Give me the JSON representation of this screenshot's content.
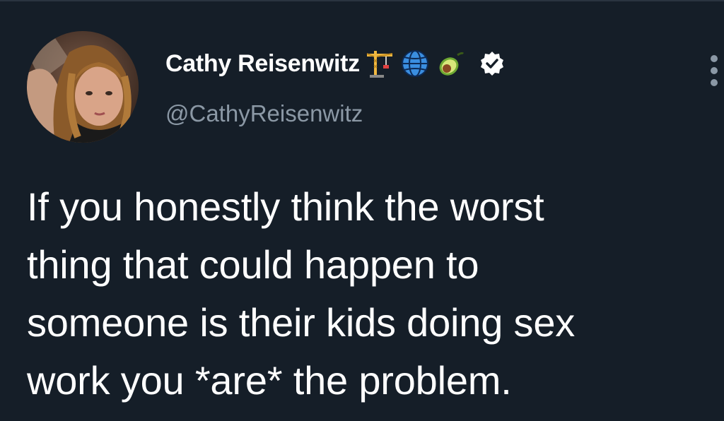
{
  "author": {
    "display_name": "Cathy Reisenwitz",
    "handle": "@CathyReisenwitz",
    "name_emojis": [
      "construction-crane-icon",
      "globe-icon",
      "avocado-icon"
    ],
    "verified": true,
    "verified_icon": "verified-badge-icon"
  },
  "tweet": {
    "lines": [
      "If you honestly think the worst",
      "thing that could happen to",
      "someone is their kids doing sex",
      "work you *are* the problem."
    ]
  },
  "menu": {
    "icon": "more-options-icon"
  },
  "colors": {
    "background": "#151e28",
    "text": "#ffffff",
    "secondary_text": "#8b98a5"
  }
}
